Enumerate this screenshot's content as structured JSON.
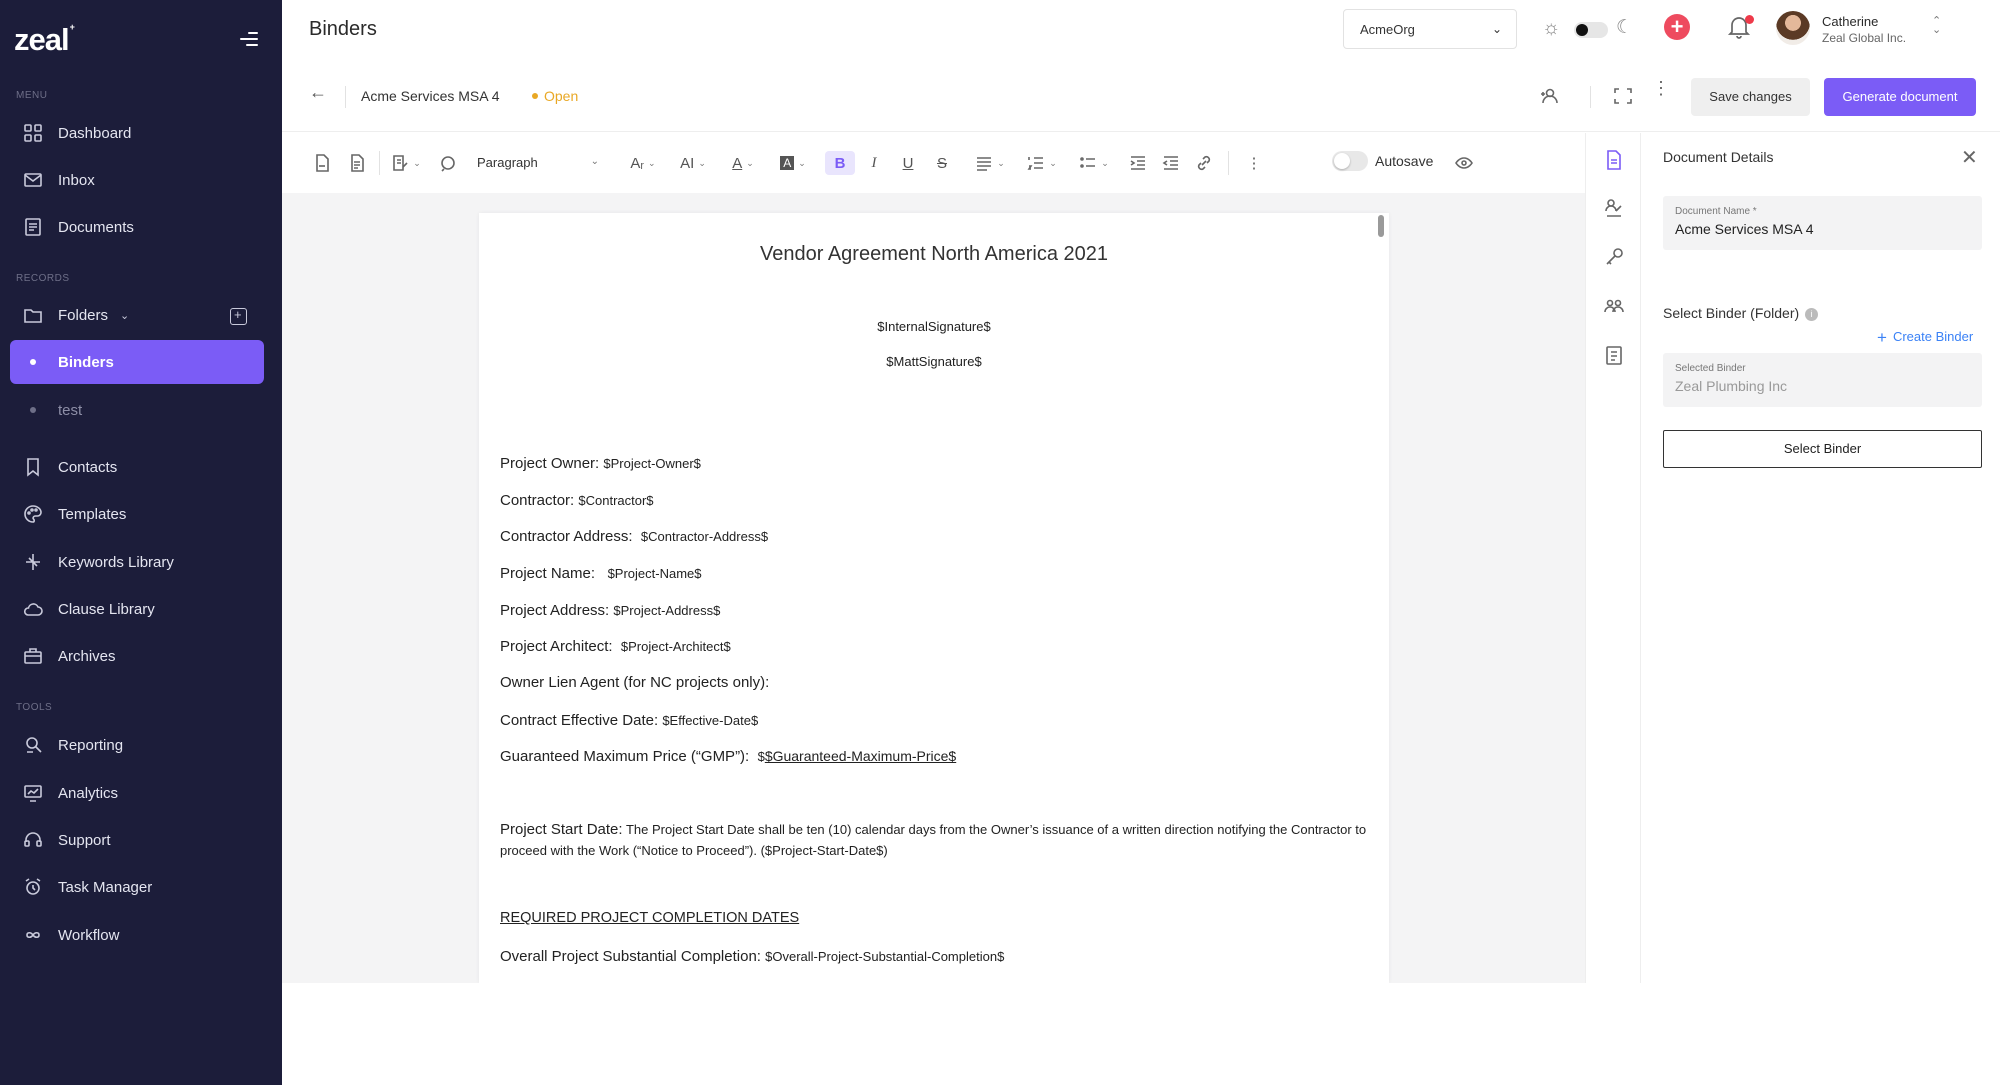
{
  "app": {
    "logo": "zeal",
    "logo_mark": "+"
  },
  "sidebar": {
    "sections": {
      "menu": "MENU",
      "records": "RECORDS",
      "tools": "TOOLS"
    },
    "items": [
      {
        "label": "Dashboard",
        "icon": "dashboard-icon"
      },
      {
        "label": "Inbox",
        "icon": "inbox-icon"
      },
      {
        "label": "Documents",
        "icon": "documents-icon"
      },
      {
        "label": "Folders",
        "icon": "folder-icon"
      },
      {
        "label": "Binders",
        "active": true
      },
      {
        "label": "test"
      },
      {
        "label": "Contacts",
        "icon": "bookmark-icon"
      },
      {
        "label": "Templates",
        "icon": "palette-icon"
      },
      {
        "label": "Keywords Library",
        "icon": "keywords-icon"
      },
      {
        "label": "Clause Library",
        "icon": "cloud-icon"
      },
      {
        "label": "Archives",
        "icon": "archive-icon"
      },
      {
        "label": "Reporting",
        "icon": "reporting-icon"
      },
      {
        "label": "Analytics",
        "icon": "analytics-icon"
      },
      {
        "label": "Support",
        "icon": "headset-icon"
      },
      {
        "label": "Task Manager",
        "icon": "alarm-icon"
      },
      {
        "label": "Workflow",
        "icon": "infinity-icon"
      }
    ]
  },
  "header": {
    "title": "Binders",
    "org_select": "AcmeOrg",
    "user": {
      "name": "Catherine",
      "org": "Zeal Global Inc."
    }
  },
  "doc_header": {
    "doc_name": "Acme Services MSA 4",
    "status": "Open",
    "save_label": "Save changes",
    "generate_label": "Generate document"
  },
  "toolbar": {
    "paragraph_style": "Paragraph",
    "bold": "B",
    "italic": "I",
    "underline": "U",
    "strike": "S",
    "autosave_label": "Autosave"
  },
  "document": {
    "title": "Vendor Agreement North America 2021",
    "signatures": [
      "$InternalSignature$",
      "$MattSignature$"
    ],
    "fields": [
      {
        "label": "Project Owner:",
        "value": "$Project-Owner$"
      },
      {
        "label": "Contractor:",
        "value": "$Contractor$"
      },
      {
        "label": "Contractor Address:",
        "value": "$Contractor-Address$"
      },
      {
        "label": "Project Name:",
        "value": "$Project-Name$"
      },
      {
        "label": "Project Address:",
        "value": "$Project-Address$"
      },
      {
        "label": "Project Architect:",
        "value": "$Project-Architect$"
      },
      {
        "label": "Owner Lien Agent (for NC projects only):",
        "value": ""
      },
      {
        "label": "Contract Effective Date:",
        "value": "$Effective-Date$"
      },
      {
        "label": "Guaranteed Maximum Price (“GMP”):",
        "prefix": "$",
        "value": "$Guaranteed-Maximum-Price$"
      }
    ],
    "start_date": {
      "label": "Project Start Date:",
      "text": "The Project Start Date shall be ten (10) calendar days from the Owner’s issuance of a written direction notifying the Contractor to proceed with the Work (“Notice to Proceed”). ($Project-Start-Date$)"
    },
    "completion_heading": "REQUIRED PROJECT COMPLETION DATES",
    "completion_field": {
      "label": "Overall Project Substantial Completion:",
      "value": "$Overall-Project-Substantial-Completion$"
    }
  },
  "details_panel": {
    "title": "Document Details",
    "doc_name_label": "Document Name *",
    "doc_name_value": "Acme Services MSA 4",
    "select_binder_label": "Select Binder (Folder)",
    "create_binder": "Create Binder",
    "selected_binder_label": "Selected Binder",
    "selected_binder_value": "Zeal Plumbing Inc",
    "select_binder_button": "Select Binder"
  },
  "colors": {
    "sidebar_bg": "#1c1d3a",
    "accent": "#7b5cf6",
    "status_open": "#e9a825",
    "link": "#3b82f6"
  }
}
